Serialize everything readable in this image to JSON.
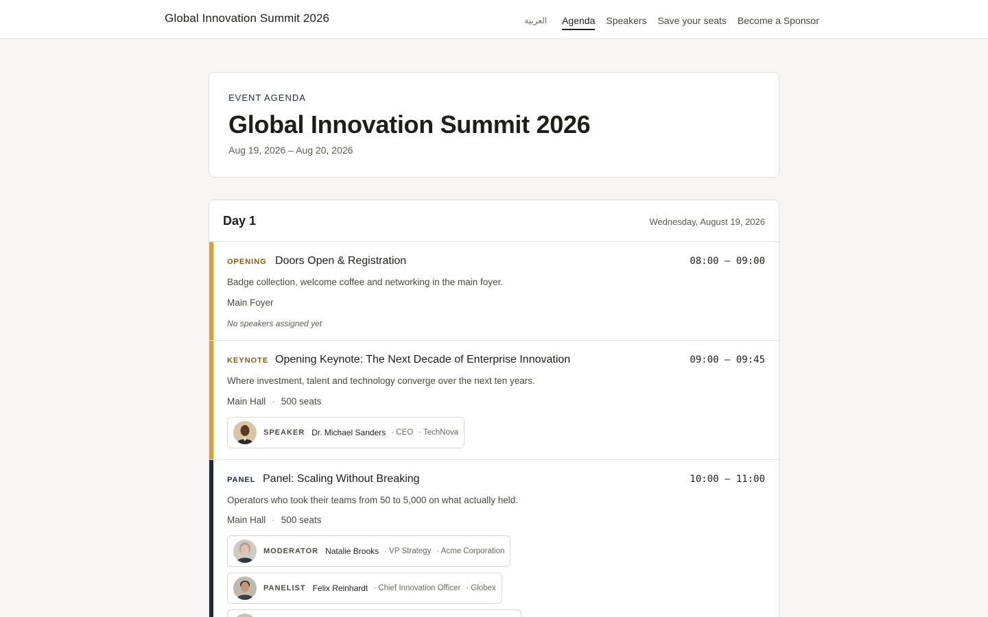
{
  "topbar": {
    "brand": "Global Innovation Summit 2026",
    "nav": [
      {
        "label": "العربية",
        "key": "lang"
      },
      {
        "label": "Agenda",
        "key": "agenda",
        "active": true
      },
      {
        "label": "Speakers",
        "key": "speakers"
      },
      {
        "label": "Save your seats",
        "key": "seats"
      },
      {
        "label": "Become a Sponsor",
        "key": "sponsor"
      }
    ]
  },
  "header": {
    "eyebrow": "EVENT AGENDA",
    "title": "Global Innovation Summit 2026",
    "dates": "Aug 19, 2026 – Aug 20, 2026"
  },
  "day": {
    "title": "Day 1",
    "date": "Wednesday, August 19, 2026",
    "sessions": [
      {
        "type": "OPENING",
        "type_color": "#8a5a12",
        "accent": "#e8982c",
        "title": "Doors Open & Registration",
        "time": "08:00 – 09:00",
        "description": "Badge collection, welcome coffee and networking in the main foyer.",
        "location": "Main Foyer",
        "seats": "",
        "no_speakers": "No speakers assigned yet",
        "speakers": []
      },
      {
        "type": "KEYNOTE",
        "type_color": "#8a5a12",
        "accent": "#e8982c",
        "title": "Opening Keynote: The Next Decade of Enterprise Innovation",
        "time": "09:00 – 09:45",
        "description": "Where investment, talent and technology converge over the next ten years.",
        "location": "Main Hall",
        "seats": "500 seats",
        "speakers": [
          {
            "role": "SPEAKER",
            "name": "Dr. Michael Sanders",
            "title": "· CEO",
            "company": "· TechNova",
            "avatar_bg": "#d9c4a8",
            "skin": "#5a3a26"
          }
        ]
      },
      {
        "type": "PANEL",
        "type_color": "#1a2a44",
        "accent": "#1a2a44",
        "title": "Panel: Scaling Without Breaking",
        "time": "10:00 – 11:00",
        "description": "Operators who took their teams from 50 to 5,000 on what actually held.",
        "location": "Main Hall",
        "seats": "500 seats",
        "speakers": [
          {
            "role": "MODERATOR",
            "name": "Natalie Brooks",
            "title": "· VP Strategy",
            "company": "· Acme Corporation",
            "avatar_bg": "#cfcac2",
            "skin": "#e2c2a6"
          },
          {
            "role": "PANELIST",
            "name": "Felix Reinhardt",
            "title": "· Chief Innovation Officer",
            "company": "· Globex",
            "avatar_bg": "#bfb8ae",
            "skin": "#c49474"
          }
        ]
      }
    ]
  }
}
